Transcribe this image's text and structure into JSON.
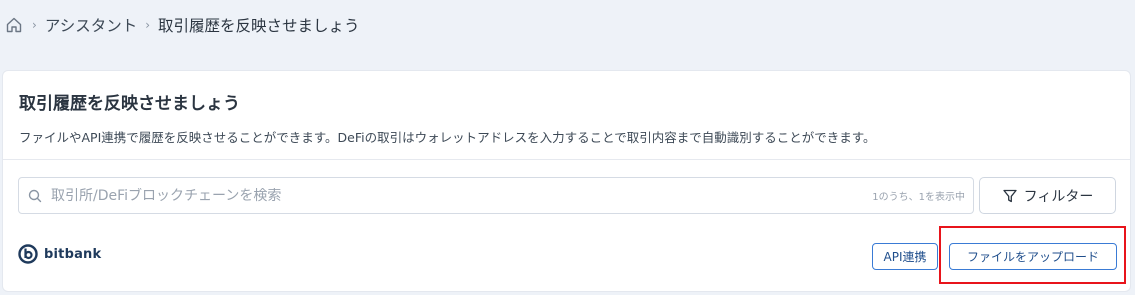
{
  "breadcrumb": {
    "items": [
      "アシスタント",
      "取引履歴を反映させましょう"
    ]
  },
  "card": {
    "title": "取引履歴を反映させましょう",
    "description": "ファイルやAPI連携で履歴を反映させることができます。DeFiの取引はウォレットアドレスを入力することで取引内容まで自動識別することができます。"
  },
  "search": {
    "placeholder": "取引所/DeFiブロックチェーンを検索",
    "value": "",
    "result_count": "1のうち、1を表示中"
  },
  "filter": {
    "label": "フィルター"
  },
  "exchanges": [
    {
      "name": "bitbank",
      "api_label": "API連携",
      "upload_label": "ファイルをアップロード"
    }
  ],
  "colors": {
    "accent": "#3a7bd5",
    "highlight": "#e8141b",
    "background": "#eef2f8"
  }
}
